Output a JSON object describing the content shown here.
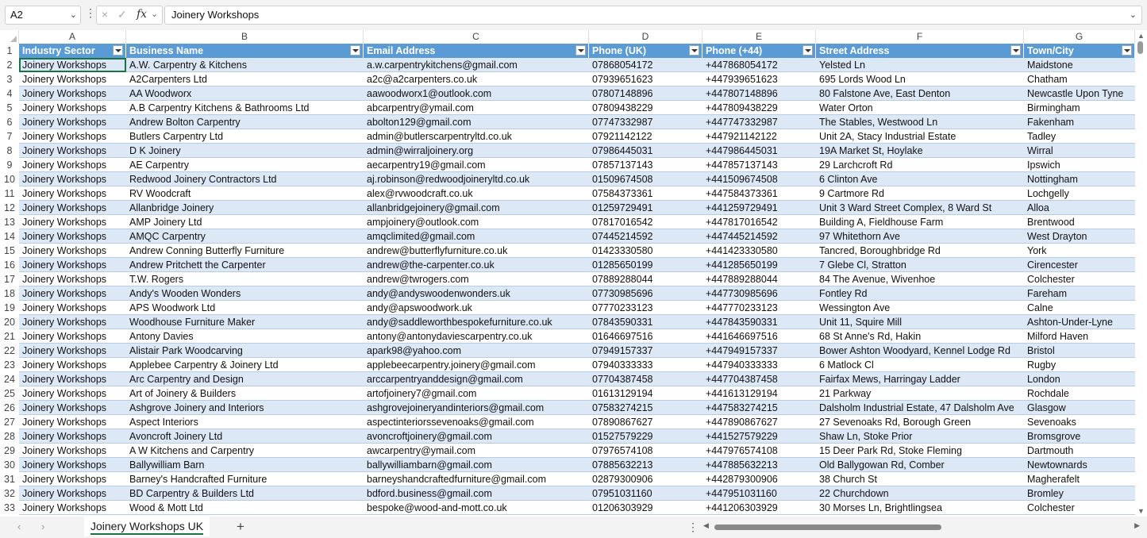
{
  "formula_bar": {
    "name_box": "A2",
    "formula_value": "Joinery Workshops",
    "cancel_icon": "×",
    "enter_icon": "✓",
    "fx_label": "fx"
  },
  "columns": [
    "A",
    "B",
    "C",
    "D",
    "E",
    "F",
    "G"
  ],
  "headers": [
    "Industry Sector",
    "Business Name",
    "Email Address",
    "Phone (UK)",
    "Phone (+44)",
    "Street Address",
    "Town/City"
  ],
  "rows": [
    [
      "Joinery Workshops",
      "A.W. Carpentry & Kitchens",
      "a.w.carpentrykitchens@gmail.com",
      "07868054172",
      "+447868054172",
      "Yelsted Ln",
      "Maidstone"
    ],
    [
      "Joinery Workshops",
      "A2Carpenters Ltd",
      "a2c@a2carpenters.co.uk",
      "07939651623",
      "+447939651623",
      "695 Lords Wood Ln",
      "Chatham"
    ],
    [
      "Joinery Workshops",
      "AA Woodworx",
      "aawoodworx1@outlook.com",
      "07807148896",
      "+447807148896",
      "80 Falstone Ave, East Denton",
      "Newcastle Upon Tyne"
    ],
    [
      "Joinery Workshops",
      "A.B Carpentry Kitchens & Bathrooms Ltd",
      "abcarpentry@ymail.com",
      "07809438229",
      "+447809438229",
      "Water Orton",
      "Birmingham"
    ],
    [
      "Joinery Workshops",
      "Andrew Bolton Carpentry",
      "abolton129@gmail.com",
      "07747332987",
      "+447747332987",
      "The Stables, Westwood Ln",
      "Fakenham"
    ],
    [
      "Joinery Workshops",
      "Butlers Carpentry Ltd",
      "admin@butlerscarpentryltd.co.uk",
      "07921142122",
      "+447921142122",
      "Unit 2A, Stacy Industrial Estate",
      "Tadley"
    ],
    [
      "Joinery Workshops",
      "D K Joinery",
      "admin@wirraljoinery.org",
      "07986445031",
      "+447986445031",
      "19A Market St, Hoylake",
      "Wirral"
    ],
    [
      "Joinery Workshops",
      "AE Carpentry",
      "aecarpentry19@gmail.com",
      "07857137143",
      "+447857137143",
      "29 Larchcroft Rd",
      "Ipswich"
    ],
    [
      "Joinery Workshops",
      "Redwood Joinery Contractors Ltd",
      "aj.robinson@redwoodjoineryltd.co.uk",
      "01509674508",
      "+441509674508",
      "6 Clinton Ave",
      "Nottingham"
    ],
    [
      "Joinery Workshops",
      "RV Woodcraft",
      "alex@rvwoodcraft.co.uk",
      "07584373361",
      "+447584373361",
      "9 Cartmore Rd",
      "Lochgelly"
    ],
    [
      "Joinery Workshops",
      "Allanbridge Joinery",
      "allanbridgejoinery@gmail.com",
      "01259729491",
      "+441259729491",
      "Unit 3 Ward Street Complex, 8 Ward St",
      "Alloa"
    ],
    [
      "Joinery Workshops",
      "AMP Joinery Ltd",
      "ampjoinery@outlook.com",
      "07817016542",
      "+447817016542",
      "Building A, Fieldhouse Farm",
      "Brentwood"
    ],
    [
      "Joinery Workshops",
      "AMQC Carpentry",
      "amqclimited@gmail.com",
      "07445214592",
      "+447445214592",
      "97 Whitethorn Ave",
      "West Drayton"
    ],
    [
      "Joinery Workshops",
      "Andrew Conning Butterfly Furniture",
      "andrew@butterflyfurniture.co.uk",
      "01423330580",
      "+441423330580",
      "Tancred, Boroughbridge Rd",
      "York"
    ],
    [
      "Joinery Workshops",
      "Andrew Pritchett the Carpenter",
      "andrew@the-carpenter.co.uk",
      "01285650199",
      "+441285650199",
      "7 Glebe Cl, Stratton",
      "Cirencester"
    ],
    [
      "Joinery Workshops",
      "T.W. Rogers",
      "andrew@twrogers.com",
      "07889288044",
      "+447889288044",
      "84 The Avenue, Wivenhoe",
      "Colchester"
    ],
    [
      "Joinery Workshops",
      "Andy's Wooden Wonders",
      "andy@andyswoodenwonders.uk",
      "07730985696",
      "+447730985696",
      "Fontley Rd",
      "Fareham"
    ],
    [
      "Joinery Workshops",
      "APS Woodwork Ltd",
      "andy@apswoodwork.uk",
      "07770233123",
      "+447770233123",
      "Wessington Ave",
      "Calne"
    ],
    [
      "Joinery Workshops",
      "Woodhouse Furniture Maker",
      "andy@saddleworthbespokefurniture.co.uk",
      "07843590331",
      "+447843590331",
      "Unit 11, Squire Mill",
      "Ashton-Under-Lyne"
    ],
    [
      "Joinery Workshops",
      "Antony Davies",
      "antony@antonydaviescarpentry.co.uk",
      "01646697516",
      "+441646697516",
      "68 St Anne's Rd, Hakin",
      "Milford Haven"
    ],
    [
      "Joinery Workshops",
      "Alistair Park Woodcarving",
      "apark98@yahoo.com",
      "07949157337",
      "+447949157337",
      "Bower Ashton Woodyard, Kennel Lodge Rd",
      "Bristol"
    ],
    [
      "Joinery Workshops",
      "Applebee Carpentry & Joinery Ltd",
      "applebeecarpentry.joinery@gmail.com",
      "07940333333",
      "+447940333333",
      "6 Matlock Cl",
      "Rugby"
    ],
    [
      "Joinery Workshops",
      "Arc Carpentry and Design",
      "arccarpentryanddesign@gmail.com",
      "07704387458",
      "+447704387458",
      "Fairfax Mews, Harringay Ladder",
      "London"
    ],
    [
      "Joinery Workshops",
      "Art of Joinery & Builders",
      "artofjoinery7@gmail.com",
      "01613129194",
      "+441613129194",
      "21 Parkway",
      "Rochdale"
    ],
    [
      "Joinery Workshops",
      "Ashgrove Joinery and Interiors",
      "ashgrovejoineryandinteriors@gmail.com",
      "07583274215",
      "+447583274215",
      "Dalsholm Industrial Estate, 47 Dalsholm Ave",
      "Glasgow"
    ],
    [
      "Joinery Workshops",
      "Aspect Interiors",
      "aspectinteriorssevenoaks@gmail.com",
      "07890867627",
      "+447890867627",
      "27 Sevenoaks Rd, Borough Green",
      "Sevenoaks"
    ],
    [
      "Joinery Workshops",
      "Avoncroft Joinery Ltd",
      "avoncroftjoinery@gmail.com",
      "01527579229",
      "+441527579229",
      "Shaw Ln, Stoke Prior",
      "Bromsgrove"
    ],
    [
      "Joinery Workshops",
      "A W Kitchens and Carpentry",
      "awcarpentry@ymail.com",
      "07976574108",
      "+447976574108",
      "15 Deer Park Rd, Stoke Fleming",
      "Dartmouth"
    ],
    [
      "Joinery Workshops",
      "Ballywilliam Barn",
      "ballywilliambarn@gmail.com",
      "07885632213",
      "+447885632213",
      "Old Ballygowan Rd, Comber",
      "Newtownards"
    ],
    [
      "Joinery Workshops",
      "Barney's Handcrafted Furniture",
      "barneyshandcraftedfurniture@gmail.com",
      "02879300906",
      "+442879300906",
      "38 Church St",
      "Magherafelt"
    ],
    [
      "Joinery Workshops",
      "BD Carpentry & Builders Ltd",
      "bdford.business@gmail.com",
      "07951031160",
      "+447951031160",
      "22 Churchdown",
      "Bromley"
    ],
    [
      "Joinery Workshops",
      "Wood & Mott Ltd",
      "bespoke@wood-and-mott.co.uk",
      "01206303929",
      "+441206303929",
      "30 Morses Ln, Brightlingsea",
      "Colchester"
    ]
  ],
  "sheet_tab": "Joinery Workshops UK",
  "add_sheet_label": "+",
  "colors": {
    "header_fill": "#5b9bd5",
    "band_fill": "#dde8f6",
    "selection": "#1a7343"
  }
}
